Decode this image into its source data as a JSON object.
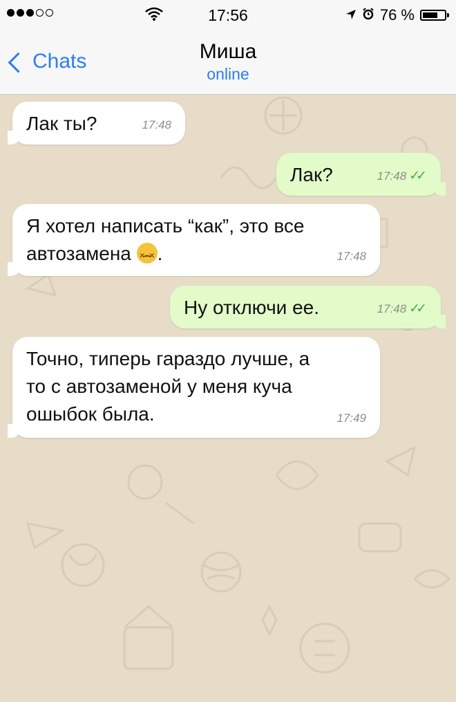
{
  "status": {
    "time": "17:56",
    "battery_text": "76 %",
    "battery_level": 0.76
  },
  "nav": {
    "back_label": "Chats",
    "contact_name": "Миша",
    "contact_status": "online"
  },
  "messages": [
    {
      "dir": "in",
      "text": "Лак ты?",
      "time": "17:48"
    },
    {
      "dir": "out",
      "text": "Лак?",
      "time": "17:48",
      "ticks": "✓✓"
    },
    {
      "dir": "in",
      "text": "Я хотел написать “как”, это все\nавтозамена",
      "emoji": "confounded-face",
      "after_emoji": ".",
      "time": "17:48"
    },
    {
      "dir": "out",
      "text": "Ну отключи ее.",
      "time": "17:48",
      "ticks": "✓✓"
    },
    {
      "dir": "in",
      "text": "Точно, типерь гараздо лучше, а\nто с автозаменой у меня куча\nошыбок была.",
      "time": "17:49"
    }
  ],
  "colors": {
    "accent": "#2a7df6",
    "incoming": "#ffffff",
    "outgoing": "#e2fbc9",
    "wallpaper": "#e6dcc8",
    "ticks": "#3fb13f"
  }
}
